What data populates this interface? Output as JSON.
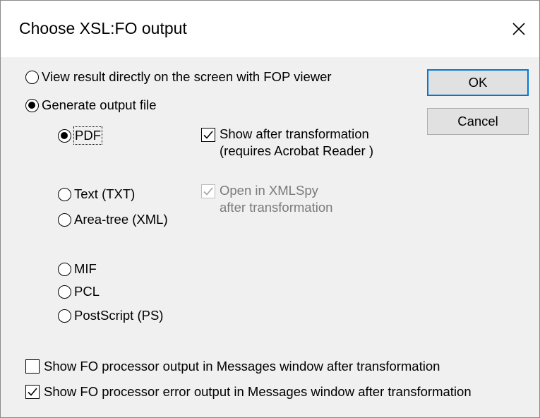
{
  "window": {
    "title": "Choose XSL:FO output"
  },
  "output_mode": {
    "view_on_screen_label": "View result directly on the screen with FOP viewer",
    "generate_file_label": "Generate output file"
  },
  "formats": {
    "pdf": "PDF",
    "txt": "Text (TXT)",
    "area_tree": "Area-tree (XML)",
    "mif": "MIF",
    "pcl": "PCL",
    "ps": "PostScript (PS)"
  },
  "pdf_option": {
    "line1": "Show after transformation",
    "line2": "(requires Acrobat Reader )"
  },
  "xml_option": {
    "line1": "Open in XMLSpy",
    "line2": "after transformation"
  },
  "messages": {
    "show_output": "Show FO processor output in Messages window after transformation",
    "show_errors": "Show FO processor error output in Messages window after transformation"
  },
  "buttons": {
    "ok": "OK",
    "cancel": "Cancel"
  },
  "colors": {
    "dialog_bg": "#f0f0f0",
    "default_button_border": "#0078d7",
    "disabled_text": "#7a7a7a"
  }
}
